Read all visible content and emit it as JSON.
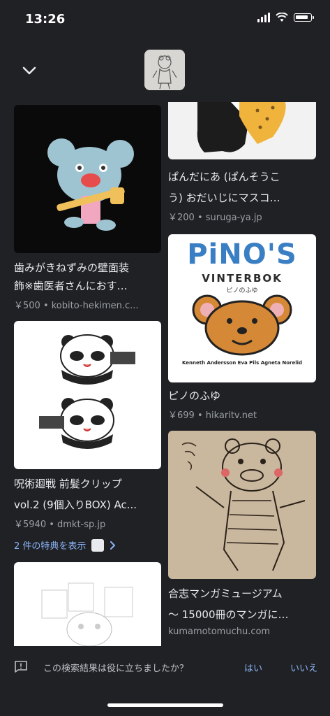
{
  "status_bar": {
    "time": "13:26"
  },
  "header": {
    "back_icon": "chevron-down-icon",
    "thumbnail_icon": "sketch-thumbnail"
  },
  "results": {
    "left": [
      {
        "title_line1": "歯みがきねずみの壁面装",
        "title_line2": "飾※歯医者さんにおす…",
        "meta": "￥500 • kobito-hekimen.c..."
      },
      {
        "title_line1": "呪術廻戦 前髪クリップ",
        "title_line2": "vol.2 (9個入りBOX) Ac...",
        "meta": "￥5940 • dmkt-sp.jp",
        "extra": "2 件の特典を表示"
      },
      {
        "title_line1": "",
        "title_line2": "",
        "meta": ""
      }
    ],
    "right": [
      {
        "title_line1": "ぱんだにあ (ぱんそうこ",
        "title_line2": "う) おだいじにマスコ…",
        "meta": "￥200 • suruga-ya.jp"
      },
      {
        "cover_title": "PiNO'S",
        "cover_subtitle": "VINTERBOK",
        "cover_jp": "ピノのふゆ",
        "cover_authors": "Kenneth Andersson   Eva Pils   Agneta Norelid",
        "title_line1": "ピノのふゆ",
        "meta": "￥699 • hikaritv.net"
      },
      {
        "title_line1": "合志マンガミュージアム",
        "title_line2": "～ 15000冊のマンガに…",
        "meta": "kumamotomuchu.com"
      }
    ]
  },
  "feedback": {
    "question": "この検索結果は役に立ちましたか？",
    "yes": "はい",
    "no": "いいえ"
  }
}
